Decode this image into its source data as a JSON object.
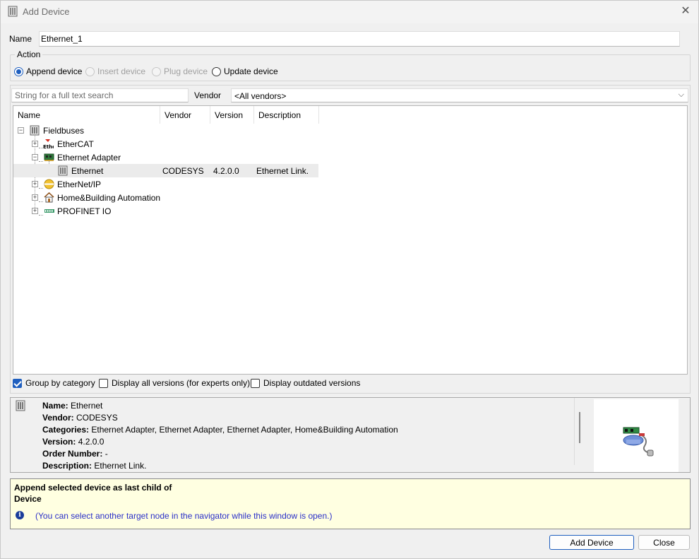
{
  "window": {
    "title": "Add Device",
    "icon": "device-icon",
    "close_icon": "close-icon"
  },
  "name_field": {
    "label": "Name",
    "value": "Ethernet_1"
  },
  "action": {
    "legend": "Action",
    "options": [
      {
        "label": "Append device",
        "selected": true,
        "enabled": true
      },
      {
        "label": "Insert device",
        "selected": false,
        "enabled": false
      },
      {
        "label": "Plug device",
        "selected": false,
        "enabled": false
      },
      {
        "label": "Update device",
        "selected": false,
        "enabled": true
      }
    ]
  },
  "search": {
    "placeholder": "String for a full text search",
    "value": ""
  },
  "vendor": {
    "label": "Vendor",
    "selected": "<All vendors>"
  },
  "tree": {
    "columns": [
      "Name",
      "Vendor",
      "Version",
      "Description"
    ],
    "rows": [
      {
        "name": "Fieldbuses",
        "vendor": "",
        "version": "",
        "description": "",
        "icon": "fieldbus-icon",
        "expander": "−",
        "level": 0
      },
      {
        "name": "EtherCAT",
        "vendor": "",
        "version": "",
        "description": "",
        "icon": "ethercat-icon",
        "expander": "+",
        "level": 1
      },
      {
        "name": "Ethernet Adapter",
        "vendor": "",
        "version": "",
        "description": "",
        "icon": "ethernet-adapter-icon",
        "expander": "−",
        "level": 1
      },
      {
        "name": "Ethernet",
        "vendor": "CODESYS",
        "version": "4.2.0.0",
        "description": "Ethernet Link.",
        "icon": "device-icon",
        "expander": "",
        "level": 2,
        "selected": true
      },
      {
        "name": "EtherNet/IP",
        "vendor": "",
        "version": "",
        "description": "",
        "icon": "ethernetip-icon",
        "expander": "+",
        "level": 1
      },
      {
        "name": "Home&Building Automation",
        "vendor": "",
        "version": "",
        "description": "",
        "icon": "home-icon",
        "expander": "+",
        "level": 1
      },
      {
        "name": "PROFINET IO",
        "vendor": "",
        "version": "",
        "description": "",
        "icon": "profinet-icon",
        "expander": "+",
        "level": 1
      }
    ]
  },
  "options": {
    "group_by_category": {
      "label": "Group by category",
      "checked": true
    },
    "display_all_versions": {
      "label": "Display all versions (for experts only)",
      "checked": false
    },
    "display_outdated": {
      "label": "Display outdated versions",
      "checked": false
    }
  },
  "info": {
    "name": {
      "key": "Name:",
      "value": "Ethernet"
    },
    "vendor": {
      "key": "Vendor:",
      "value": "CODESYS"
    },
    "categories": {
      "key": "Categories:",
      "value": "Ethernet Adapter, Ethernet Adapter, Ethernet Adapter, Home&Building Automation"
    },
    "version": {
      "key": "Version:",
      "value": "4.2.0.0"
    },
    "order_number": {
      "key": "Order Number:",
      "value": "-"
    },
    "description": {
      "key": "Description:",
      "value": "Ethernet Link."
    }
  },
  "hint": {
    "line1": "Append selected device as last child of",
    "line2": "Device",
    "note": "(You can select another target node in the navigator while this window is open.)"
  },
  "buttons": {
    "add": "Add Device",
    "close": "Close"
  },
  "colors": {
    "accent": "#1f5fbf",
    "hint_bg": "#ffffe1",
    "hint_text": "#2b30c8"
  }
}
